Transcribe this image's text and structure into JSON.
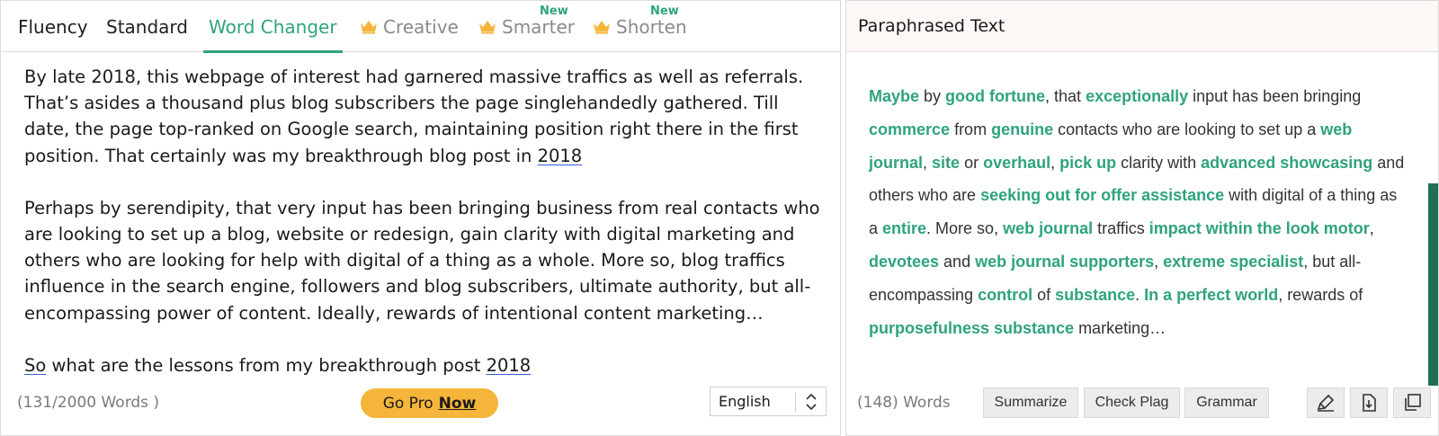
{
  "tabs": {
    "fluency": "Fluency",
    "standard": "Standard",
    "word_changer": "Word Changer",
    "creative": "Creative",
    "smarter": "Smarter",
    "shorten": "Shorten",
    "new_badge": "New",
    "active": "Word Changer"
  },
  "input": {
    "p1": {
      "text": "By late 2018, this webpage of interest had garnered massive traffics as well as referrals. That’s asides a thousand plus blog subscribers the page singlehandedly gathered. Till date, the page top-ranked on Google search, maintaining position right there in the first position. That certainly was my breakthrough blog post in ",
      "link": "2018"
    },
    "p2": "Perhaps by serendipity, that very input has been bringing business from real contacts who are looking to set up a blog, website or redesign, gain clarity with digital marketing and others who are looking for help with digital of a thing as a whole. More so, blog traffics influence in the search engine, followers and blog subscribers, ultimate authority, but all-encompassing power of content. Ideally, rewards of intentional content marketing…",
    "p3": {
      "link1": "So",
      "text": " what are the lessons from my breakthrough post ",
      "link2": "2018"
    },
    "word_count": "(131/2000 Words )",
    "go_pro": "Go Pro",
    "go_pro_now": "Now",
    "language": "English"
  },
  "output": {
    "header": "Paraphrased Text",
    "segments": [
      {
        "t": "Maybe",
        "h": true
      },
      {
        "t": " by ",
        "h": false
      },
      {
        "t": "good fortune",
        "h": true
      },
      {
        "t": ", that ",
        "h": false
      },
      {
        "t": "exceptionally",
        "h": true
      },
      {
        "t": " input has been bringing ",
        "h": false
      },
      {
        "t": "commerce",
        "h": true
      },
      {
        "t": " from ",
        "h": false
      },
      {
        "t": "genuine",
        "h": true
      },
      {
        "t": " contacts who are looking to set up a ",
        "h": false
      },
      {
        "t": "web journal",
        "h": true
      },
      {
        "t": ", ",
        "h": false
      },
      {
        "t": "site",
        "h": true
      },
      {
        "t": " or ",
        "h": false
      },
      {
        "t": "overhaul",
        "h": true
      },
      {
        "t": ", ",
        "h": false
      },
      {
        "t": "pick up",
        "h": true
      },
      {
        "t": " clarity with ",
        "h": false
      },
      {
        "t": "advanced showcasing",
        "h": true
      },
      {
        "t": " and others who are ",
        "h": false
      },
      {
        "t": "seeking out for offer assistance",
        "h": true
      },
      {
        "t": " with digital of a thing as a ",
        "h": false
      },
      {
        "t": "entire",
        "h": true
      },
      {
        "t": ". More so, ",
        "h": false
      },
      {
        "t": "web journal",
        "h": true
      },
      {
        "t": " traffics ",
        "h": false
      },
      {
        "t": "impact within the look motor",
        "h": true
      },
      {
        "t": ", ",
        "h": false
      },
      {
        "t": "devotees",
        "h": true
      },
      {
        "t": " and ",
        "h": false
      },
      {
        "t": "web journal supporters",
        "h": true
      },
      {
        "t": ", ",
        "h": false
      },
      {
        "t": "extreme specialist",
        "h": true
      },
      {
        "t": ", but all-encompassing ",
        "h": false
      },
      {
        "t": "control",
        "h": true
      },
      {
        "t": " of ",
        "h": false
      },
      {
        "t": "substance",
        "h": true
      },
      {
        "t": ". ",
        "h": false
      },
      {
        "t": "In a perfect world",
        "h": true
      },
      {
        "t": ", rewards of ",
        "h": false
      },
      {
        "t": "purposefulness substance",
        "h": true
      },
      {
        "t": " marketing…",
        "h": false
      }
    ],
    "word_count": "(148) Words",
    "summarize": "Summarize",
    "check_plag": "Check Plag",
    "grammar": "Grammar"
  },
  "colors": {
    "accent": "#2fa37e",
    "crown": "#f5b53a",
    "go_pro_bg": "#f5b53a",
    "scroll_thumb": "#1f6e55"
  },
  "icons": [
    "crown-icon",
    "up-down-arrows-icon",
    "highlighter-icon",
    "download-icon",
    "copy-icon"
  ]
}
